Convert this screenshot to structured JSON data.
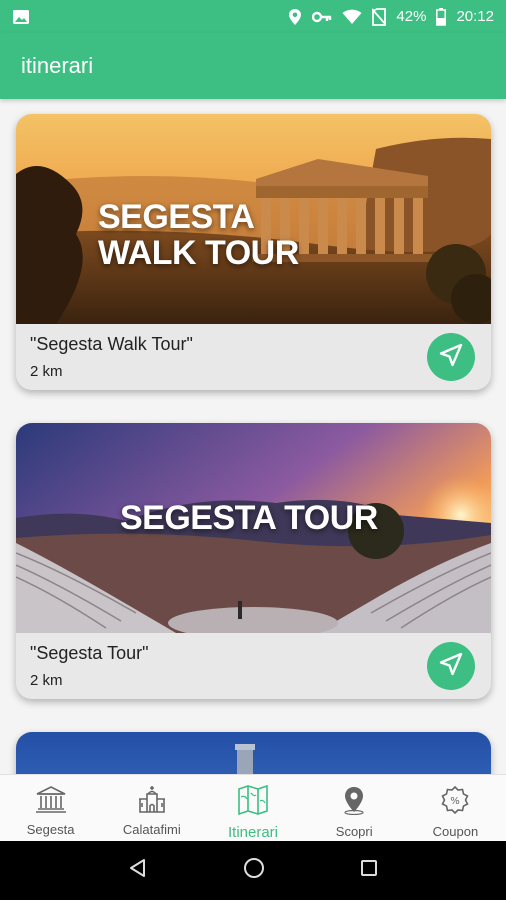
{
  "status_bar": {
    "battery": "42%",
    "time": "20:12"
  },
  "app_bar": {
    "title": "itinerari"
  },
  "tours": [
    {
      "overlay_title_line1": "SEGESTA",
      "overlay_title_line2": "WALK TOUR",
      "name": "\"Segesta Walk Tour\"",
      "distance": "2 km"
    },
    {
      "overlay_title_line1": "SEGESTA TOUR",
      "name": "\"Segesta Tour\"",
      "distance": "2 km"
    }
  ],
  "bottom_nav": {
    "items": [
      {
        "label": "Segesta",
        "icon": "temple-icon"
      },
      {
        "label": "Calatafimi",
        "icon": "church-icon"
      },
      {
        "label": "Itinerari",
        "icon": "map-icon",
        "active": true
      },
      {
        "label": "Scopri",
        "icon": "location-pin-icon"
      },
      {
        "label": "Coupon",
        "icon": "coupon-badge-icon"
      }
    ]
  },
  "colors": {
    "accent": "#3dbe83",
    "inactive": "#555555"
  }
}
